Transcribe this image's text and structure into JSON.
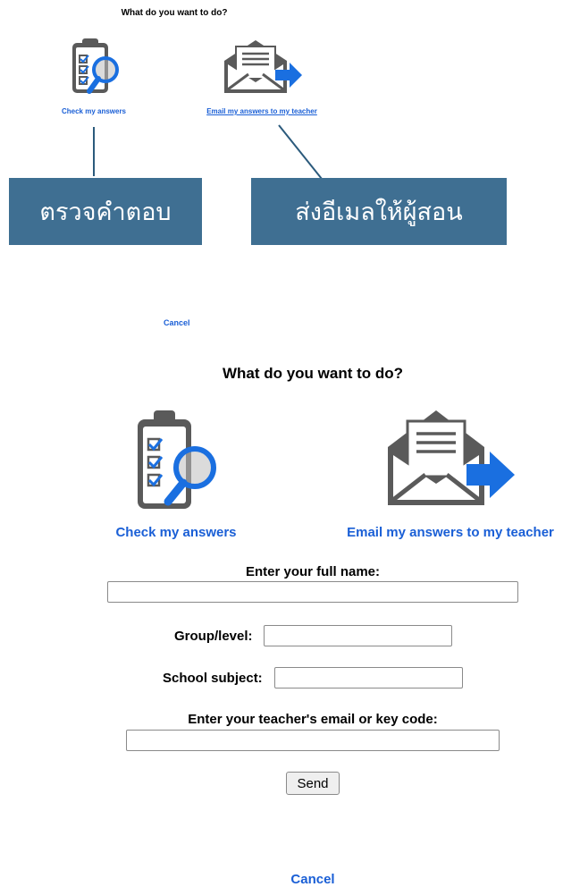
{
  "top_preview": {
    "title": "What do you want to do?",
    "check_label": "Check my answers",
    "email_label": "Email my answers to my teacher",
    "cancel_label": "Cancel"
  },
  "annotations": {
    "check_thai": "ตรวจคำตอบ",
    "email_thai": "ส่งอีเมลให้ผู้สอน"
  },
  "main": {
    "title": "What do you want to do?",
    "check_label": "Check my answers",
    "email_label": "Email my answers to my teacher"
  },
  "form": {
    "full_name_label": "Enter your full name:",
    "full_name_value": "",
    "group_label": "Group/level:",
    "group_value": "",
    "subject_label": "School subject:",
    "subject_value": "",
    "teacher_label": "Enter your teacher's email or key code:",
    "teacher_value": "",
    "send_label": "Send"
  },
  "footer": {
    "cancel_label": "Cancel"
  },
  "colors": {
    "link": "#1a5fd6",
    "annotation_bg": "#3f6f92",
    "icon_gray": "#5a5a5a",
    "icon_blue": "#1a6fe0"
  },
  "icons": {
    "check": "clipboard-magnifier-icon",
    "email": "envelope-arrow-icon"
  }
}
